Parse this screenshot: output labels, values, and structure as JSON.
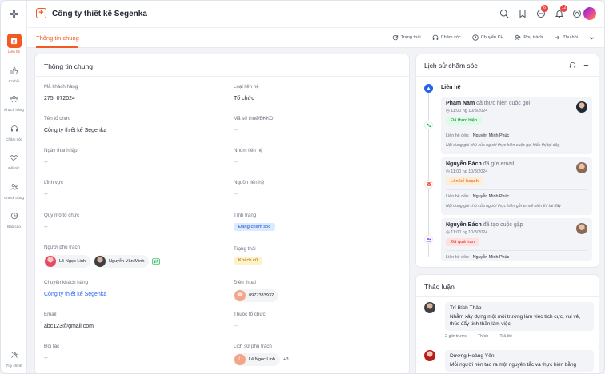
{
  "header": {
    "company_name": "Công ty thiết kế Segenka",
    "notification_badge_1": "6",
    "notification_badge_2": "12"
  },
  "sidebar": {
    "items": [
      {
        "label": "Liên hệ",
        "icon": "contact-icon",
        "active": true
      },
      {
        "label": "Cơ hội",
        "icon": "thumbs-up-icon"
      },
      {
        "label": "Khách hàng",
        "icon": "customers-icon"
      },
      {
        "label": "Chăm sóc",
        "icon": "headset-icon"
      },
      {
        "label": "Đối tác",
        "icon": "handshake-icon"
      },
      {
        "label": "Check trùng",
        "icon": "duplicate-users-icon"
      },
      {
        "label": "Báo cáo",
        "icon": "report-icon"
      }
    ],
    "bottom_label": "Tùy chỉnh"
  },
  "tabs": {
    "main": "Thông tin chung",
    "actions": [
      "Trạng thái",
      "Chăm sóc",
      "Chuyển KH",
      "Phụ trách",
      "Thu hồi"
    ]
  },
  "info": {
    "title": "Thông tin chung",
    "customer_code_label": "Mã khách hàng",
    "customer_code": "275_072024",
    "contact_type_label": "Loại liên hệ",
    "contact_type": "Tổ chức",
    "org_name_label": "Tên tổ chức",
    "org_name": "Công ty thiết kế Segenka",
    "tax_label": "Mã số thuế/ĐKKD",
    "tax_value": "--",
    "founded_label": "Ngày thành lập",
    "founded_value": "--",
    "group_label": "Nhóm liên hệ",
    "group_value": "--",
    "field_label": "Lĩnh vực",
    "field_value": "--",
    "source_label": "Nguồn liên hệ",
    "source_value": "--",
    "scale_label": "Quy mô tổ chức",
    "scale_value": "--",
    "condition_label": "Tình trạng",
    "condition_value": "Đang chăm sóc",
    "owner_label": "Người phụ trách",
    "owner_1": "Lê Ngọc Linh",
    "owner_2": "Nguyễn Văn Minh",
    "status_label": "Trạng thái",
    "status_value": "Khách cũ",
    "transfer_label": "Chuyển khách hàng",
    "transfer_value": "Công ty thiết kế Segenka",
    "phone_label": "Điện thoại",
    "phone_value": "0977333932",
    "email_label": "Email",
    "email_value": "abc123@gmail.com",
    "belongs_label": "Thuộc tổ chức",
    "belongs_value": "--",
    "partner_label": "Đối tác",
    "partner_value": "--",
    "owner_history_label": "Lịch sử phụ trách",
    "owner_history_name": "Lê Ngọc Linh",
    "owner_history_more": "+3"
  },
  "history": {
    "title": "Lịch sử chăm sóc",
    "group_label": "Liên hệ",
    "entries": [
      {
        "name": "Phạm Nam",
        "action": "đã thực hiện cuộc gọi",
        "time": "11:00 ng 10/8/2024",
        "tag": "Đã thực hiện",
        "contact_label": "Liên hệ đến:",
        "contact": "Nguyễn Minh Phúc",
        "note": "Nội dung ghi chú của người thực hiện cuộc gọi hiển thị tại đây"
      },
      {
        "name": "Nguyễn Bách",
        "action": "đã gửi email",
        "time": "11:00 ng 10/8/2024",
        "tag": "Lên kế hoạch",
        "contact_label": "Liên hệ đến:",
        "contact": "Nguyễn Minh Phúc",
        "note": "Nội dung ghi chú của người thực hiện gửi email hiển thị tại đây"
      },
      {
        "name": "Nguyễn Bách",
        "action": "đã tạo cuộc gặp",
        "time": "11:00 ng 10/8/2024",
        "tag": "Đã quá hạn",
        "contact_label": "Liên hệ đến:",
        "contact": "Nguyễn Minh Phúc"
      }
    ]
  },
  "discussion": {
    "title": "Thảo luận",
    "comments": [
      {
        "name": "Trí Bích Thảo",
        "text": "Nhằm xây dựng một môi trường làm việc tích cực, vui vẻ, thúc đẩy tinh thần làm việc",
        "time": "2 giờ trước",
        "like": "Thích",
        "reply": "Trả lời"
      },
      {
        "name": "Dương Hoàng Yến",
        "text": "Mỗi người nên tạo ra một nguyên tắc và thực hiện bằng"
      }
    ]
  }
}
